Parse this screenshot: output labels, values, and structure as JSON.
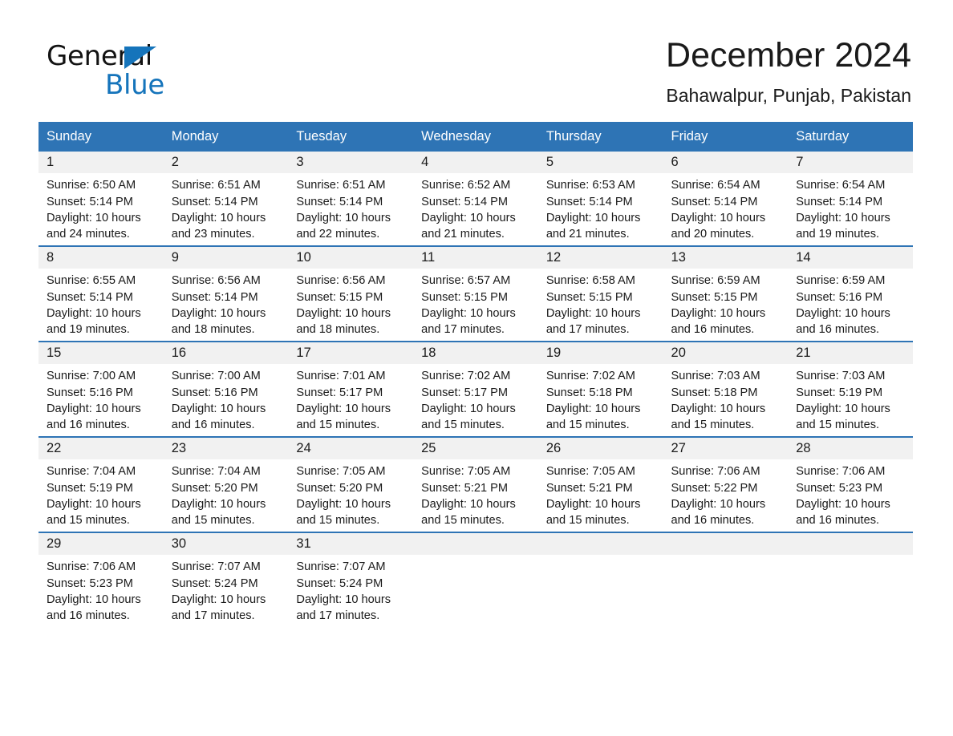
{
  "brand": {
    "name_part1": "General",
    "name_part2": "Blue",
    "triangle_color": "#1574bb"
  },
  "header": {
    "title": "December 2024",
    "subtitle": "Bahawalpur, Punjab, Pakistan",
    "accent_color": "#2e74b5",
    "daynum_bg": "#f1f1f1"
  },
  "weekdays": [
    "Sunday",
    "Monday",
    "Tuesday",
    "Wednesday",
    "Thursday",
    "Friday",
    "Saturday"
  ],
  "weeks": [
    [
      {
        "day": "1",
        "sunrise": "Sunrise: 6:50 AM",
        "sunset": "Sunset: 5:14 PM",
        "daylight_line1": "Daylight: 10 hours",
        "daylight_line2": "and 24 minutes."
      },
      {
        "day": "2",
        "sunrise": "Sunrise: 6:51 AM",
        "sunset": "Sunset: 5:14 PM",
        "daylight_line1": "Daylight: 10 hours",
        "daylight_line2": "and 23 minutes."
      },
      {
        "day": "3",
        "sunrise": "Sunrise: 6:51 AM",
        "sunset": "Sunset: 5:14 PM",
        "daylight_line1": "Daylight: 10 hours",
        "daylight_line2": "and 22 minutes."
      },
      {
        "day": "4",
        "sunrise": "Sunrise: 6:52 AM",
        "sunset": "Sunset: 5:14 PM",
        "daylight_line1": "Daylight: 10 hours",
        "daylight_line2": "and 21 minutes."
      },
      {
        "day": "5",
        "sunrise": "Sunrise: 6:53 AM",
        "sunset": "Sunset: 5:14 PM",
        "daylight_line1": "Daylight: 10 hours",
        "daylight_line2": "and 21 minutes."
      },
      {
        "day": "6",
        "sunrise": "Sunrise: 6:54 AM",
        "sunset": "Sunset: 5:14 PM",
        "daylight_line1": "Daylight: 10 hours",
        "daylight_line2": "and 20 minutes."
      },
      {
        "day": "7",
        "sunrise": "Sunrise: 6:54 AM",
        "sunset": "Sunset: 5:14 PM",
        "daylight_line1": "Daylight: 10 hours",
        "daylight_line2": "and 19 minutes."
      }
    ],
    [
      {
        "day": "8",
        "sunrise": "Sunrise: 6:55 AM",
        "sunset": "Sunset: 5:14 PM",
        "daylight_line1": "Daylight: 10 hours",
        "daylight_line2": "and 19 minutes."
      },
      {
        "day": "9",
        "sunrise": "Sunrise: 6:56 AM",
        "sunset": "Sunset: 5:14 PM",
        "daylight_line1": "Daylight: 10 hours",
        "daylight_line2": "and 18 minutes."
      },
      {
        "day": "10",
        "sunrise": "Sunrise: 6:56 AM",
        "sunset": "Sunset: 5:15 PM",
        "daylight_line1": "Daylight: 10 hours",
        "daylight_line2": "and 18 minutes."
      },
      {
        "day": "11",
        "sunrise": "Sunrise: 6:57 AM",
        "sunset": "Sunset: 5:15 PM",
        "daylight_line1": "Daylight: 10 hours",
        "daylight_line2": "and 17 minutes."
      },
      {
        "day": "12",
        "sunrise": "Sunrise: 6:58 AM",
        "sunset": "Sunset: 5:15 PM",
        "daylight_line1": "Daylight: 10 hours",
        "daylight_line2": "and 17 minutes."
      },
      {
        "day": "13",
        "sunrise": "Sunrise: 6:59 AM",
        "sunset": "Sunset: 5:15 PM",
        "daylight_line1": "Daylight: 10 hours",
        "daylight_line2": "and 16 minutes."
      },
      {
        "day": "14",
        "sunrise": "Sunrise: 6:59 AM",
        "sunset": "Sunset: 5:16 PM",
        "daylight_line1": "Daylight: 10 hours",
        "daylight_line2": "and 16 minutes."
      }
    ],
    [
      {
        "day": "15",
        "sunrise": "Sunrise: 7:00 AM",
        "sunset": "Sunset: 5:16 PM",
        "daylight_line1": "Daylight: 10 hours",
        "daylight_line2": "and 16 minutes."
      },
      {
        "day": "16",
        "sunrise": "Sunrise: 7:00 AM",
        "sunset": "Sunset: 5:16 PM",
        "daylight_line1": "Daylight: 10 hours",
        "daylight_line2": "and 16 minutes."
      },
      {
        "day": "17",
        "sunrise": "Sunrise: 7:01 AM",
        "sunset": "Sunset: 5:17 PM",
        "daylight_line1": "Daylight: 10 hours",
        "daylight_line2": "and 15 minutes."
      },
      {
        "day": "18",
        "sunrise": "Sunrise: 7:02 AM",
        "sunset": "Sunset: 5:17 PM",
        "daylight_line1": "Daylight: 10 hours",
        "daylight_line2": "and 15 minutes."
      },
      {
        "day": "19",
        "sunrise": "Sunrise: 7:02 AM",
        "sunset": "Sunset: 5:18 PM",
        "daylight_line1": "Daylight: 10 hours",
        "daylight_line2": "and 15 minutes."
      },
      {
        "day": "20",
        "sunrise": "Sunrise: 7:03 AM",
        "sunset": "Sunset: 5:18 PM",
        "daylight_line1": "Daylight: 10 hours",
        "daylight_line2": "and 15 minutes."
      },
      {
        "day": "21",
        "sunrise": "Sunrise: 7:03 AM",
        "sunset": "Sunset: 5:19 PM",
        "daylight_line1": "Daylight: 10 hours",
        "daylight_line2": "and 15 minutes."
      }
    ],
    [
      {
        "day": "22",
        "sunrise": "Sunrise: 7:04 AM",
        "sunset": "Sunset: 5:19 PM",
        "daylight_line1": "Daylight: 10 hours",
        "daylight_line2": "and 15 minutes."
      },
      {
        "day": "23",
        "sunrise": "Sunrise: 7:04 AM",
        "sunset": "Sunset: 5:20 PM",
        "daylight_line1": "Daylight: 10 hours",
        "daylight_line2": "and 15 minutes."
      },
      {
        "day": "24",
        "sunrise": "Sunrise: 7:05 AM",
        "sunset": "Sunset: 5:20 PM",
        "daylight_line1": "Daylight: 10 hours",
        "daylight_line2": "and 15 minutes."
      },
      {
        "day": "25",
        "sunrise": "Sunrise: 7:05 AM",
        "sunset": "Sunset: 5:21 PM",
        "daylight_line1": "Daylight: 10 hours",
        "daylight_line2": "and 15 minutes."
      },
      {
        "day": "26",
        "sunrise": "Sunrise: 7:05 AM",
        "sunset": "Sunset: 5:21 PM",
        "daylight_line1": "Daylight: 10 hours",
        "daylight_line2": "and 15 minutes."
      },
      {
        "day": "27",
        "sunrise": "Sunrise: 7:06 AM",
        "sunset": "Sunset: 5:22 PM",
        "daylight_line1": "Daylight: 10 hours",
        "daylight_line2": "and 16 minutes."
      },
      {
        "day": "28",
        "sunrise": "Sunrise: 7:06 AM",
        "sunset": "Sunset: 5:23 PM",
        "daylight_line1": "Daylight: 10 hours",
        "daylight_line2": "and 16 minutes."
      }
    ],
    [
      {
        "day": "29",
        "sunrise": "Sunrise: 7:06 AM",
        "sunset": "Sunset: 5:23 PM",
        "daylight_line1": "Daylight: 10 hours",
        "daylight_line2": "and 16 minutes."
      },
      {
        "day": "30",
        "sunrise": "Sunrise: 7:07 AM",
        "sunset": "Sunset: 5:24 PM",
        "daylight_line1": "Daylight: 10 hours",
        "daylight_line2": "and 17 minutes."
      },
      {
        "day": "31",
        "sunrise": "Sunrise: 7:07 AM",
        "sunset": "Sunset: 5:24 PM",
        "daylight_line1": "Daylight: 10 hours",
        "daylight_line2": "and 17 minutes."
      },
      {
        "day": "",
        "sunrise": "",
        "sunset": "",
        "daylight_line1": "",
        "daylight_line2": ""
      },
      {
        "day": "",
        "sunrise": "",
        "sunset": "",
        "daylight_line1": "",
        "daylight_line2": ""
      },
      {
        "day": "",
        "sunrise": "",
        "sunset": "",
        "daylight_line1": "",
        "daylight_line2": ""
      },
      {
        "day": "",
        "sunrise": "",
        "sunset": "",
        "daylight_line1": "",
        "daylight_line2": ""
      }
    ]
  ]
}
